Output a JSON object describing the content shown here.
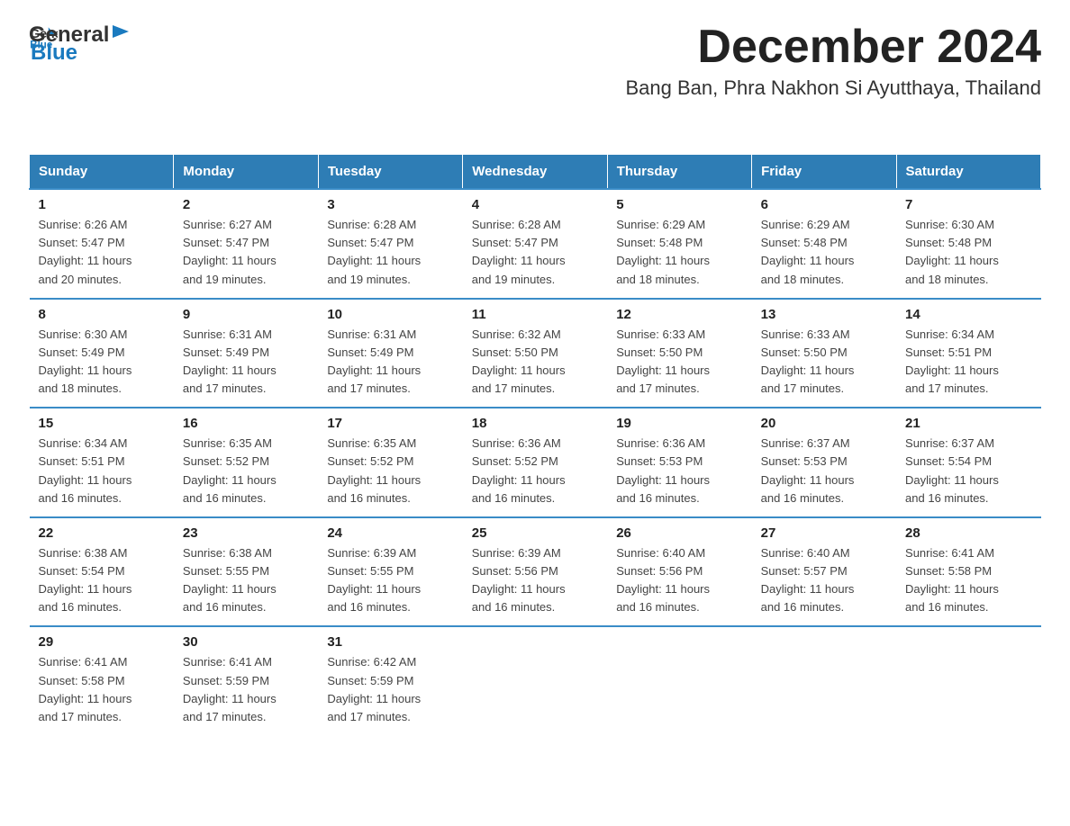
{
  "logo": {
    "general": "General",
    "arrow": "▶",
    "blue": "Blue"
  },
  "title": "December 2024",
  "subtitle": "Bang Ban, Phra Nakhon Si Ayutthaya, Thailand",
  "days_of_week": [
    "Sunday",
    "Monday",
    "Tuesday",
    "Wednesday",
    "Thursday",
    "Friday",
    "Saturday"
  ],
  "weeks": [
    [
      {
        "day": "1",
        "sunrise": "6:26 AM",
        "sunset": "5:47 PM",
        "daylight": "11 hours and 20 minutes."
      },
      {
        "day": "2",
        "sunrise": "6:27 AM",
        "sunset": "5:47 PM",
        "daylight": "11 hours and 19 minutes."
      },
      {
        "day": "3",
        "sunrise": "6:28 AM",
        "sunset": "5:47 PM",
        "daylight": "11 hours and 19 minutes."
      },
      {
        "day": "4",
        "sunrise": "6:28 AM",
        "sunset": "5:47 PM",
        "daylight": "11 hours and 19 minutes."
      },
      {
        "day": "5",
        "sunrise": "6:29 AM",
        "sunset": "5:48 PM",
        "daylight": "11 hours and 18 minutes."
      },
      {
        "day": "6",
        "sunrise": "6:29 AM",
        "sunset": "5:48 PM",
        "daylight": "11 hours and 18 minutes."
      },
      {
        "day": "7",
        "sunrise": "6:30 AM",
        "sunset": "5:48 PM",
        "daylight": "11 hours and 18 minutes."
      }
    ],
    [
      {
        "day": "8",
        "sunrise": "6:30 AM",
        "sunset": "5:49 PM",
        "daylight": "11 hours and 18 minutes."
      },
      {
        "day": "9",
        "sunrise": "6:31 AM",
        "sunset": "5:49 PM",
        "daylight": "11 hours and 17 minutes."
      },
      {
        "day": "10",
        "sunrise": "6:31 AM",
        "sunset": "5:49 PM",
        "daylight": "11 hours and 17 minutes."
      },
      {
        "day": "11",
        "sunrise": "6:32 AM",
        "sunset": "5:50 PM",
        "daylight": "11 hours and 17 minutes."
      },
      {
        "day": "12",
        "sunrise": "6:33 AM",
        "sunset": "5:50 PM",
        "daylight": "11 hours and 17 minutes."
      },
      {
        "day": "13",
        "sunrise": "6:33 AM",
        "sunset": "5:50 PM",
        "daylight": "11 hours and 17 minutes."
      },
      {
        "day": "14",
        "sunrise": "6:34 AM",
        "sunset": "5:51 PM",
        "daylight": "11 hours and 17 minutes."
      }
    ],
    [
      {
        "day": "15",
        "sunrise": "6:34 AM",
        "sunset": "5:51 PM",
        "daylight": "11 hours and 16 minutes."
      },
      {
        "day": "16",
        "sunrise": "6:35 AM",
        "sunset": "5:52 PM",
        "daylight": "11 hours and 16 minutes."
      },
      {
        "day": "17",
        "sunrise": "6:35 AM",
        "sunset": "5:52 PM",
        "daylight": "11 hours and 16 minutes."
      },
      {
        "day": "18",
        "sunrise": "6:36 AM",
        "sunset": "5:52 PM",
        "daylight": "11 hours and 16 minutes."
      },
      {
        "day": "19",
        "sunrise": "6:36 AM",
        "sunset": "5:53 PM",
        "daylight": "11 hours and 16 minutes."
      },
      {
        "day": "20",
        "sunrise": "6:37 AM",
        "sunset": "5:53 PM",
        "daylight": "11 hours and 16 minutes."
      },
      {
        "day": "21",
        "sunrise": "6:37 AM",
        "sunset": "5:54 PM",
        "daylight": "11 hours and 16 minutes."
      }
    ],
    [
      {
        "day": "22",
        "sunrise": "6:38 AM",
        "sunset": "5:54 PM",
        "daylight": "11 hours and 16 minutes."
      },
      {
        "day": "23",
        "sunrise": "6:38 AM",
        "sunset": "5:55 PM",
        "daylight": "11 hours and 16 minutes."
      },
      {
        "day": "24",
        "sunrise": "6:39 AM",
        "sunset": "5:55 PM",
        "daylight": "11 hours and 16 minutes."
      },
      {
        "day": "25",
        "sunrise": "6:39 AM",
        "sunset": "5:56 PM",
        "daylight": "11 hours and 16 minutes."
      },
      {
        "day": "26",
        "sunrise": "6:40 AM",
        "sunset": "5:56 PM",
        "daylight": "11 hours and 16 minutes."
      },
      {
        "day": "27",
        "sunrise": "6:40 AM",
        "sunset": "5:57 PM",
        "daylight": "11 hours and 16 minutes."
      },
      {
        "day": "28",
        "sunrise": "6:41 AM",
        "sunset": "5:58 PM",
        "daylight": "11 hours and 16 minutes."
      }
    ],
    [
      {
        "day": "29",
        "sunrise": "6:41 AM",
        "sunset": "5:58 PM",
        "daylight": "11 hours and 17 minutes."
      },
      {
        "day": "30",
        "sunrise": "6:41 AM",
        "sunset": "5:59 PM",
        "daylight": "11 hours and 17 minutes."
      },
      {
        "day": "31",
        "sunrise": "6:42 AM",
        "sunset": "5:59 PM",
        "daylight": "11 hours and 17 minutes."
      },
      null,
      null,
      null,
      null
    ]
  ],
  "labels": {
    "sunrise_prefix": "Sunrise: ",
    "sunset_prefix": "Sunset: ",
    "daylight_prefix": "Daylight: "
  }
}
